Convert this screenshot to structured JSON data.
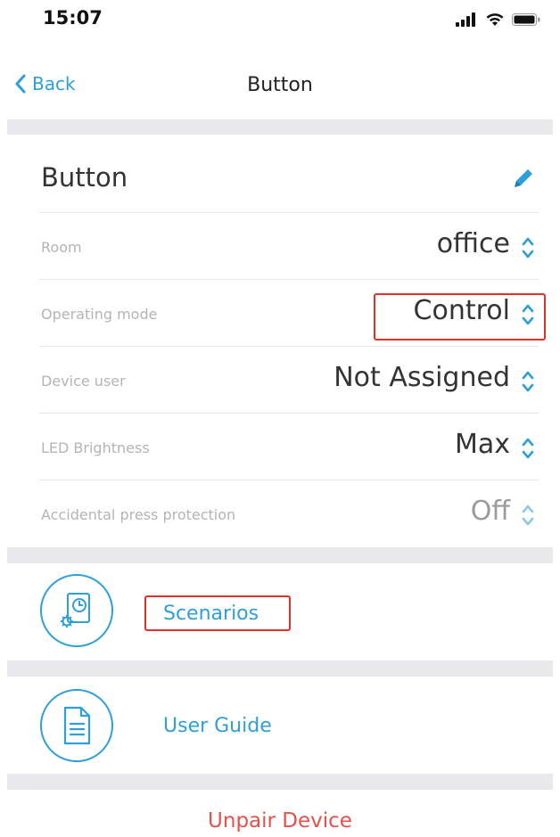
{
  "status_bar": {
    "time": "15:07"
  },
  "nav": {
    "back_label": "Back",
    "title": "Button"
  },
  "device": {
    "name": "Button"
  },
  "settings": [
    {
      "label": "Room",
      "value": "office"
    },
    {
      "label": "Operating mode",
      "value": "Control"
    },
    {
      "label": "Device user",
      "value": "Not Assigned"
    },
    {
      "label": "LED Brightness",
      "value": "Max"
    },
    {
      "label": "Accidental press protection",
      "value": "Off"
    }
  ],
  "links": {
    "scenarios": "Scenarios",
    "user_guide": "User Guide"
  },
  "unpair_label": "Unpair Device",
  "colors": {
    "accent": "#2e9fd8",
    "danger": "#e8504b",
    "highlight": "#e0302e"
  },
  "icons": [
    "signal-icon",
    "wifi-icon",
    "battery-icon",
    "chevron-left-icon",
    "pencil-icon",
    "chevron-up-down-icon",
    "scenario-gear-icon",
    "document-icon"
  ]
}
